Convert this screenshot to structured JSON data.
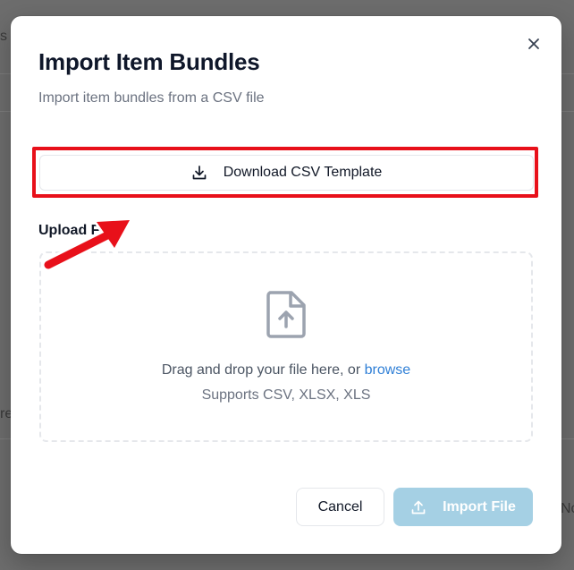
{
  "background": {
    "fragments": [
      "s",
      "re",
      "No"
    ]
  },
  "modal": {
    "title": "Import Item Bundles",
    "subtitle": "Import item bundles from a CSV file",
    "close_icon": "close-icon",
    "download_button": {
      "label": "Download CSV Template",
      "icon": "download-icon"
    },
    "upload_label": "Upload File",
    "dropzone": {
      "icon": "file-upload-icon",
      "text": "Drag and drop your file here, or",
      "link": "browse",
      "supports": "Supports CSV, XLSX, XLS"
    },
    "footer": {
      "cancel_label": "Cancel",
      "import_label": "Import File",
      "import_icon": "upload-icon",
      "import_enabled": false
    }
  },
  "annotation": {
    "highlight_color": "#e8101a",
    "arrow_color": "#e8101a"
  },
  "colors": {
    "link": "#2f7fd6",
    "import_button_disabled": "#a5d0e4",
    "overlay": "#6d6d6d"
  }
}
